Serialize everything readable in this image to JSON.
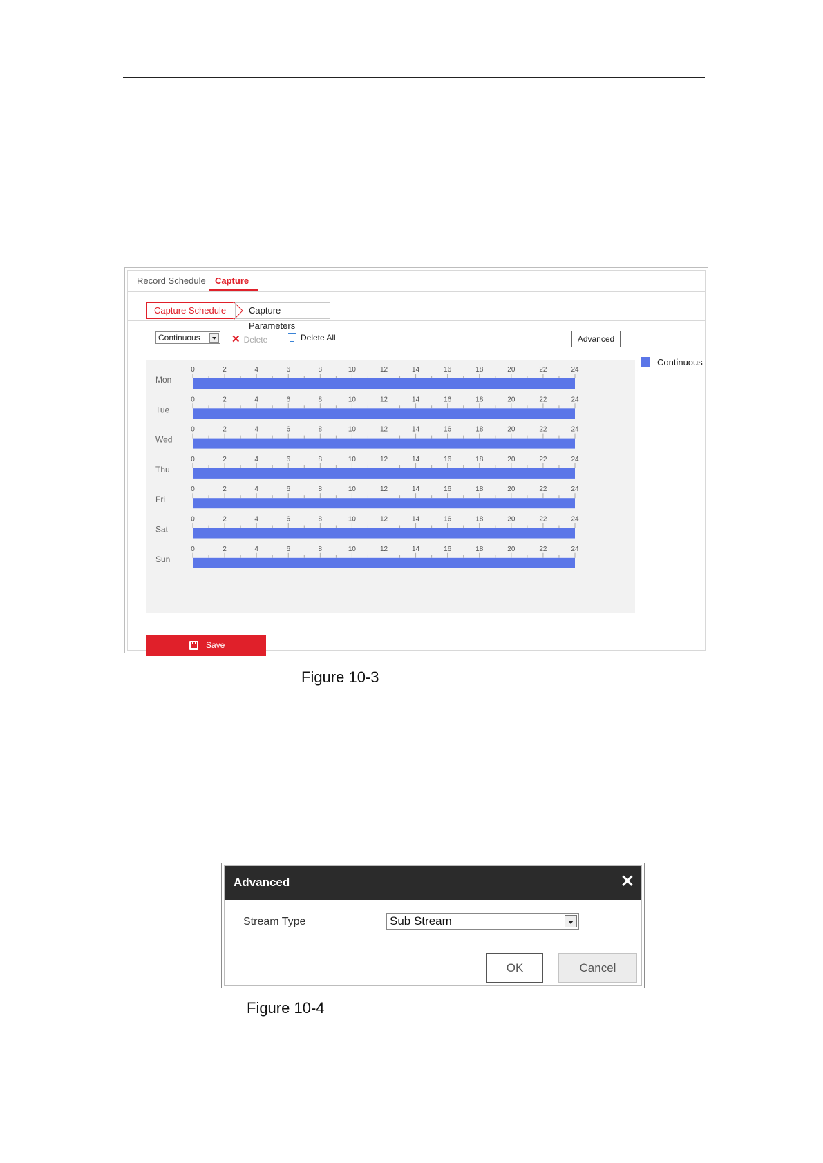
{
  "tabs": {
    "record_schedule": "Record Schedule",
    "capture": "Capture"
  },
  "sub_tabs": {
    "capture_schedule": "Capture Schedule",
    "capture_parameters": "Capture Parameters"
  },
  "toolbar": {
    "mode_select": "Continuous",
    "delete": "Delete",
    "delete_all": "Delete All",
    "advanced": "Advanced"
  },
  "legend": {
    "continuous": "Continuous",
    "color": "#5b76e8"
  },
  "schedule": {
    "hour_ticks": [
      "0",
      "2",
      "4",
      "6",
      "8",
      "10",
      "12",
      "14",
      "16",
      "18",
      "20",
      "22",
      "24"
    ],
    "days": [
      {
        "label": "Mon",
        "start": 0,
        "end": 24
      },
      {
        "label": "Tue",
        "start": 0,
        "end": 24
      },
      {
        "label": "Wed",
        "start": 0,
        "end": 24
      },
      {
        "label": "Thu",
        "start": 0,
        "end": 24
      },
      {
        "label": "Fri",
        "start": 0,
        "end": 24
      },
      {
        "label": "Sat",
        "start": 0,
        "end": 24
      },
      {
        "label": "Sun",
        "start": 0,
        "end": 24
      }
    ]
  },
  "save": {
    "label": "Save"
  },
  "captions": {
    "fig3": "Figure 10-3",
    "fig4": "Figure 10-4"
  },
  "dialog": {
    "title": "Advanced",
    "stream_type_label": "Stream Type",
    "stream_type_value": "Sub Stream",
    "ok": "OK",
    "cancel": "Cancel"
  },
  "accent_color": "#e0202a"
}
